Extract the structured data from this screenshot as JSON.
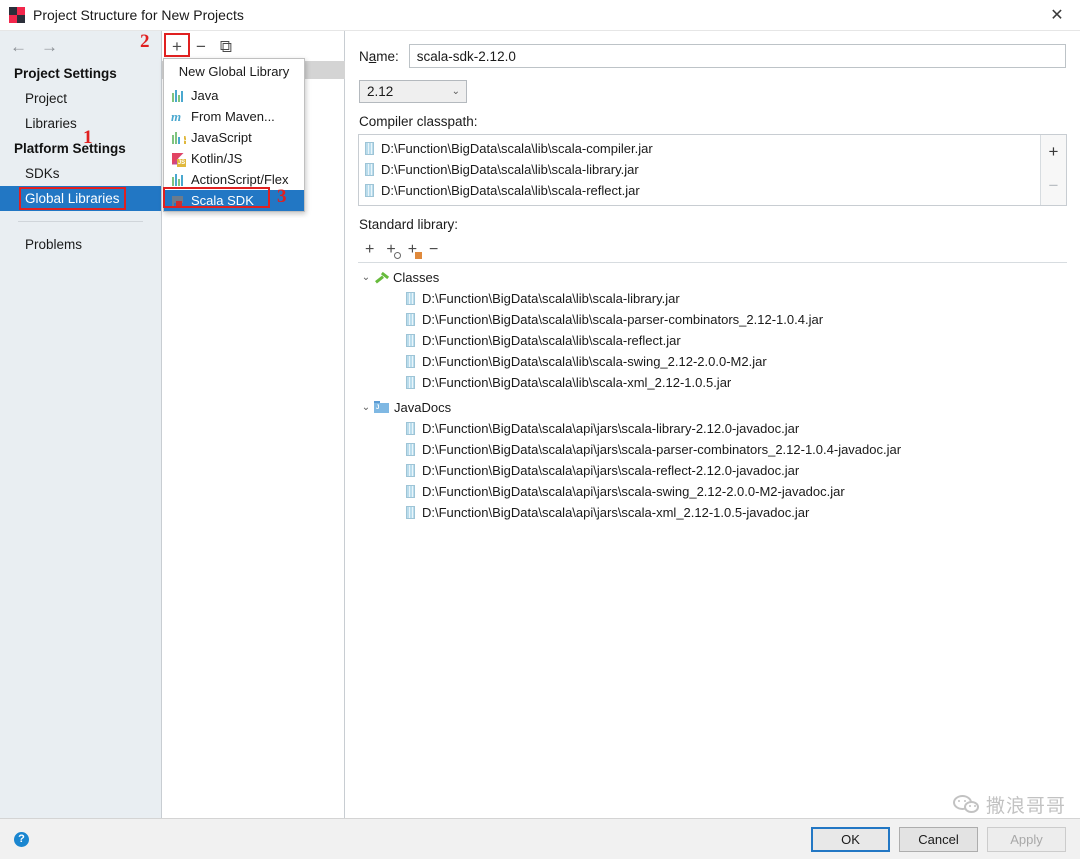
{
  "window": {
    "title": "Project Structure for New Projects",
    "app_icon": "intellij-idea-icon",
    "close_label": "✕"
  },
  "sidebar": {
    "back_label": "←",
    "forward_label": "→",
    "groups": [
      {
        "label": "Project Settings",
        "items": [
          {
            "label": "Project",
            "selected": false
          },
          {
            "label": "Libraries",
            "selected": false
          }
        ]
      },
      {
        "label": "Platform Settings",
        "items": [
          {
            "label": "SDKs",
            "selected": false
          },
          {
            "label": "Global Libraries",
            "selected": true
          }
        ]
      }
    ],
    "problems": {
      "label": "Problems"
    }
  },
  "mid_toolbar": {
    "add_label": "+",
    "remove_label": "−",
    "copy_label": "⧉"
  },
  "menu": {
    "title": "New Global Library",
    "items": [
      {
        "label": "Java",
        "icon": "java-library-icon",
        "active": false
      },
      {
        "label": "From Maven...",
        "icon": "maven-icon",
        "active": false
      },
      {
        "label": "JavaScript",
        "icon": "javascript-icon",
        "active": false
      },
      {
        "label": "Kotlin/JS",
        "icon": "kotlin-js-icon",
        "active": false
      },
      {
        "label": "ActionScript/Flex",
        "icon": "actionscript-flex-icon",
        "active": false
      },
      {
        "label": "Scala SDK",
        "icon": "scala-sdk-icon",
        "active": true
      }
    ]
  },
  "details": {
    "name_label_pre": "N",
    "name_label_mnemonic": "a",
    "name_label_post": "me:",
    "name_value": "scala-sdk-2.12.0",
    "name_placeholder": "",
    "version_selected": "2.12",
    "version_chevron": "⌄",
    "compiler_classpath_label": "Compiler classpath:",
    "compiler_classpath": [
      "D:\\Function\\BigData\\scala\\lib\\scala-compiler.jar",
      "D:\\Function\\BigData\\scala\\lib\\scala-library.jar",
      "D:\\Function\\BigData\\scala\\lib\\scala-reflect.jar"
    ],
    "cp_add_label": "+",
    "cp_remove_label": "−",
    "standard_library_label": "Standard library:",
    "std_toolbar": {
      "add_label": "+",
      "add_url_label": "+",
      "add_jar_label": "+",
      "remove_label": "−"
    },
    "tree": [
      {
        "label": "Classes",
        "icon": "classes-icon",
        "twisty": "⌄",
        "children": [
          "D:\\Function\\BigData\\scala\\lib\\scala-library.jar",
          "D:\\Function\\BigData\\scala\\lib\\scala-parser-combinators_2.12-1.0.4.jar",
          "D:\\Function\\BigData\\scala\\lib\\scala-reflect.jar",
          "D:\\Function\\BigData\\scala\\lib\\scala-swing_2.12-2.0.0-M2.jar",
          "D:\\Function\\BigData\\scala\\lib\\scala-xml_2.12-1.0.5.jar"
        ]
      },
      {
        "label": "JavaDocs",
        "icon": "javadocs-folder-icon",
        "twisty": "⌄",
        "children": [
          "D:\\Function\\BigData\\scala\\api\\jars\\scala-library-2.12.0-javadoc.jar",
          "D:\\Function\\BigData\\scala\\api\\jars\\scala-parser-combinators_2.12-1.0.4-javadoc.jar",
          "D:\\Function\\BigData\\scala\\api\\jars\\scala-reflect-2.12.0-javadoc.jar",
          "D:\\Function\\BigData\\scala\\api\\jars\\scala-swing_2.12-2.0.0-M2-javadoc.jar",
          "D:\\Function\\BigData\\scala\\api\\jars\\scala-xml_2.12-1.0.5-javadoc.jar"
        ]
      }
    ]
  },
  "footer": {
    "help_label": "?",
    "ok_label": "OK",
    "cancel_label": "Cancel",
    "apply_label": "Apply"
  },
  "annotations": [
    {
      "number": "1"
    },
    {
      "number": "2"
    },
    {
      "number": "3"
    }
  ],
  "watermark": {
    "text": "撒浪哥哥",
    "icon": "wechat-icon"
  },
  "colors": {
    "selection_blue": "#2277c4",
    "annotation_red": "#e02020",
    "footer_bg": "#f1f1f1",
    "sidebar_bg": "#e9eef2"
  }
}
